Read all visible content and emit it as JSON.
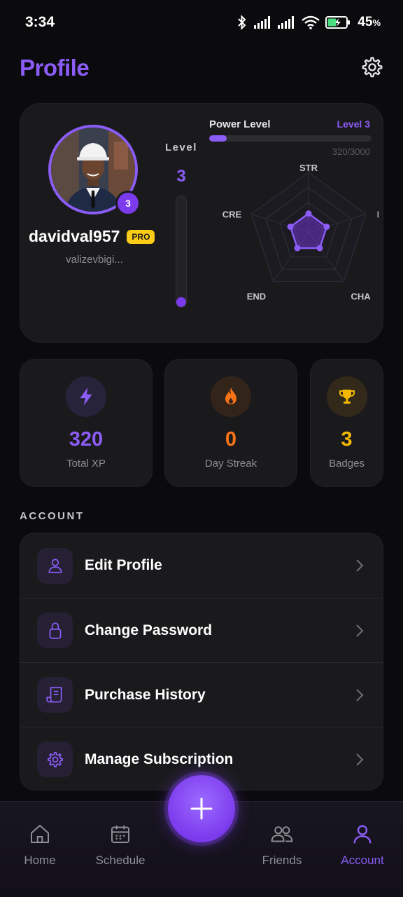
{
  "status_bar": {
    "time": "3:34",
    "battery_percent": "45",
    "battery_suffix": "%",
    "icons": [
      "bluetooth-icon",
      "signal-icon",
      "signal-icon",
      "wifi-icon",
      "battery-charging-icon"
    ]
  },
  "header": {
    "title": "Profile",
    "settings_icon": "gear-icon"
  },
  "profile": {
    "username": "davidval957",
    "badge": "PRO",
    "email": "valizevbigi...",
    "avatar_level": "3",
    "level_label": "Level",
    "level_value": "3",
    "level_progress": 0.07,
    "power_label": "Power Level",
    "power_level_tag": "Level 3",
    "power_xp": "320/3000",
    "power_progress": 0.107
  },
  "radar": {
    "axes": [
      "STR",
      "INT",
      "CHA",
      "END",
      "CRE"
    ],
    "values": [
      0.3,
      0.3,
      0.3,
      0.3,
      0.3
    ]
  },
  "stats": [
    {
      "value": "320",
      "label": "Total XP",
      "icon": "lightning-icon",
      "color": "#8b5cf6"
    },
    {
      "value": "0",
      "label": "Day Streak",
      "icon": "flame-icon",
      "color": "#f97316"
    },
    {
      "value": "3",
      "label": "Badges",
      "icon": "trophy-icon",
      "color": "#f5b800"
    }
  ],
  "account": {
    "heading": "ACCOUNT",
    "items": [
      {
        "label": "Edit Profile",
        "icon": "user-icon"
      },
      {
        "label": "Change Password",
        "icon": "lock-icon"
      },
      {
        "label": "Purchase History",
        "icon": "receipt-icon"
      },
      {
        "label": "Manage Subscription",
        "icon": "gear-icon"
      }
    ]
  },
  "nav": {
    "items": [
      {
        "label": "Home",
        "icon": "home-icon"
      },
      {
        "label": "Schedule",
        "icon": "calendar-icon"
      },
      {
        "label": "Friends",
        "icon": "friends-icon"
      },
      {
        "label": "Account",
        "icon": "account-icon"
      }
    ],
    "active": "Account",
    "fab_icon": "plus-icon"
  },
  "colors": {
    "accent": "#8b5cf6",
    "pro_badge": "#facc15",
    "streak": "#f97316",
    "badges": "#f5b800",
    "background": "#0b0b0d",
    "card": "#1a1a1d"
  }
}
